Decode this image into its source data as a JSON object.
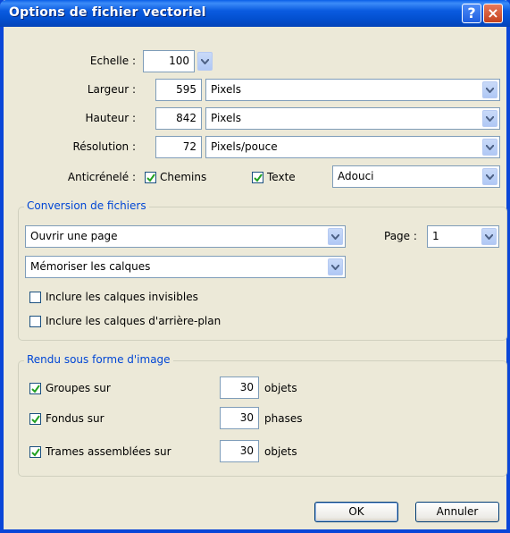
{
  "window": {
    "title": "Options de fichier vectoriel",
    "help_glyph": "?",
    "close_glyph": "×"
  },
  "scale": {
    "label": "Echelle :",
    "value": "100"
  },
  "width": {
    "label": "Largeur :",
    "value": "595",
    "unit": "Pixels"
  },
  "height": {
    "label": "Hauteur :",
    "value": "842",
    "unit": "Pixels"
  },
  "resolution": {
    "label": "Résolution :",
    "value": "72",
    "unit": "Pixels/pouce"
  },
  "antialias": {
    "label": "Anticrénelé :",
    "paths_label": "Chemins",
    "paths_checked": true,
    "text_label": "Texte",
    "text_checked": true,
    "mode": "Adouci"
  },
  "conversion": {
    "title": "Conversion de fichiers",
    "page_mode": "Ouvrir une page",
    "page_label": "Page :",
    "page_value": "1",
    "layers_mode": "Mémoriser les calques",
    "include_invisible_label": "Inclure les calques invisibles",
    "include_invisible_checked": false,
    "include_background_label": "Inclure les calques d'arrière-plan",
    "include_background_checked": false
  },
  "render": {
    "title": "Rendu sous forme d'image",
    "groups": {
      "label": "Groupes sur",
      "checked": true,
      "value": "30",
      "unit": "objets"
    },
    "blends": {
      "label": "Fondus sur",
      "checked": true,
      "value": "30",
      "unit": "phases"
    },
    "patterns": {
      "label": "Trames assemblées sur",
      "checked": true,
      "value": "30",
      "unit": "objets"
    }
  },
  "buttons": {
    "ok": "OK",
    "cancel": "Annuler"
  },
  "colors": {
    "title_bar": "#0A5BE0",
    "group_title": "#0046D5",
    "dialog_bg": "#ECE9D8"
  }
}
